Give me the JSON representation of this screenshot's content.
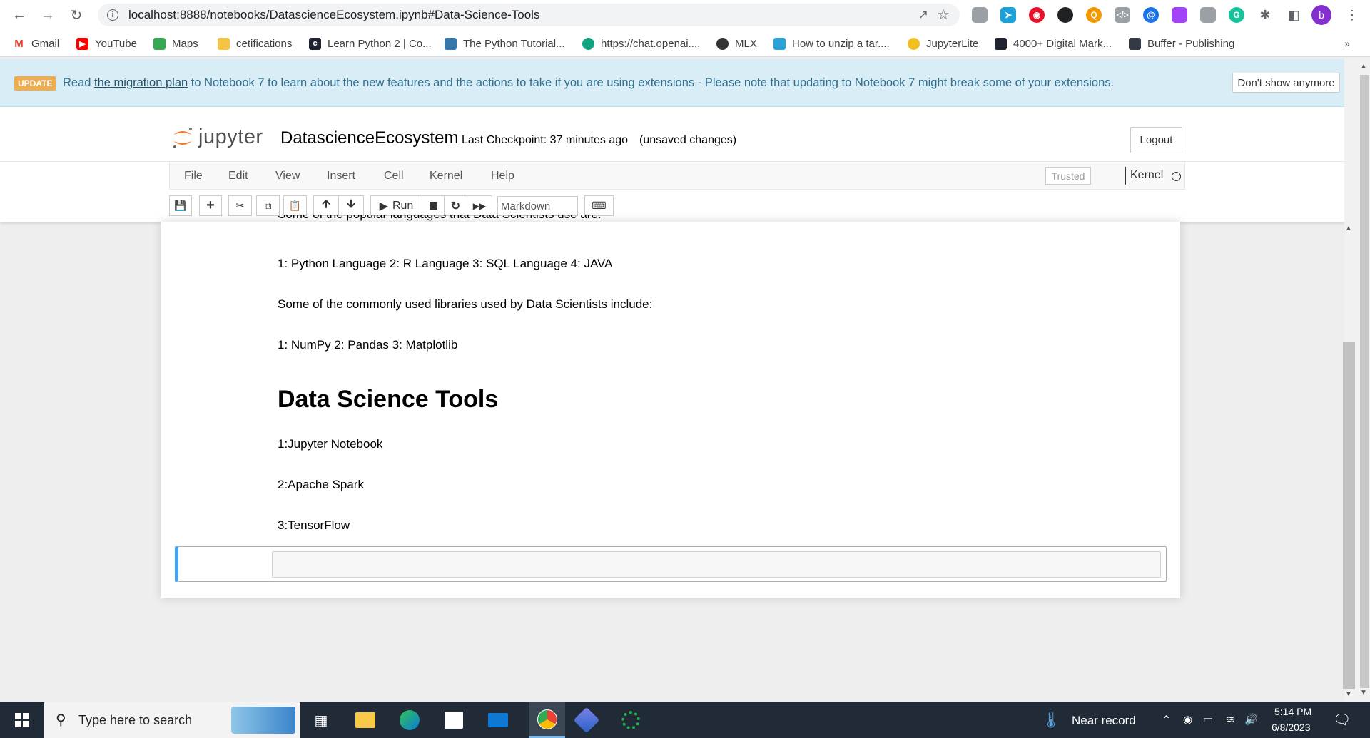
{
  "browser": {
    "url": "localhost:8888/notebooks/DatascienceEcosystem.ipynb#Data-Science-Tools",
    "profile_initial": "b"
  },
  "bookmarks": [
    {
      "label": "Gmail",
      "icon": "gmail-icon",
      "color": "#ea4335"
    },
    {
      "label": "YouTube",
      "icon": "youtube-icon",
      "color": "#ff0000"
    },
    {
      "label": "Maps",
      "icon": "maps-icon",
      "color": "#34a853"
    },
    {
      "label": "cetifications",
      "icon": "folder-icon",
      "color": "#f6c445"
    },
    {
      "label": "Learn Python 2 | Co...",
      "icon": "codecademy-icon",
      "color": "#1f2430"
    },
    {
      "label": "The Python Tutorial...",
      "icon": "python-icon",
      "color": "#3776ab"
    },
    {
      "label": "https://chat.openai....",
      "icon": "openai-icon",
      "color": "#10a37f"
    },
    {
      "label": "MLX",
      "icon": "mlx-icon",
      "color": "#333333"
    },
    {
      "label": "How to unzip a tar....",
      "icon": "unzip-icon",
      "color": "#2aa3d8"
    },
    {
      "label": "JupyterLite",
      "icon": "jupyterlite-icon",
      "color": "#f0c020"
    },
    {
      "label": "4000+ Digital Mark...",
      "icon": "digital-icon",
      "color": "#1f2430"
    },
    {
      "label": "Buffer - Publishing",
      "icon": "buffer-icon",
      "color": "#323b43"
    }
  ],
  "banner": {
    "badge": "UPDATE",
    "prefix": "Read ",
    "link": "the migration plan",
    "suffix": " to Notebook 7 to learn about the new features and the actions to take if you are using extensions - Please note that updating to Notebook 7 might break some of your extensions.",
    "dismiss": "Don't show anymore"
  },
  "jupyter": {
    "logo_text": "jupyter",
    "notebook_name": "DatascienceEcosystem",
    "checkpoint": "Last Checkpoint: 37 minutes ago",
    "unsaved": "(unsaved changes)",
    "logout": "Logout",
    "menu": [
      "File",
      "Edit",
      "View",
      "Insert",
      "Cell",
      "Kernel",
      "Help"
    ],
    "trusted": "Trusted",
    "kernel": "Kernel",
    "run_label": "Run",
    "cell_type": "Markdown"
  },
  "notebook": {
    "partial_line": "Some of the popular languages that Data Scientists use are:",
    "languages": "1: Python Language 2: R Language 3: SQL Language 4: JAVA",
    "libs_intro": "Some of the commonly used libraries used by Data Scientists include:",
    "libs": "1: NumPy 2: Pandas 3: Matplotlib",
    "tools_heading": "Data Science Tools",
    "tools": [
      "1:Jupyter Notebook",
      "2:Apache Spark",
      "3:TensorFlow"
    ]
  },
  "taskbar": {
    "search_placeholder": "Type here to search",
    "weather": "Near record",
    "time": "5:14 PM",
    "date": "6/8/2023"
  }
}
